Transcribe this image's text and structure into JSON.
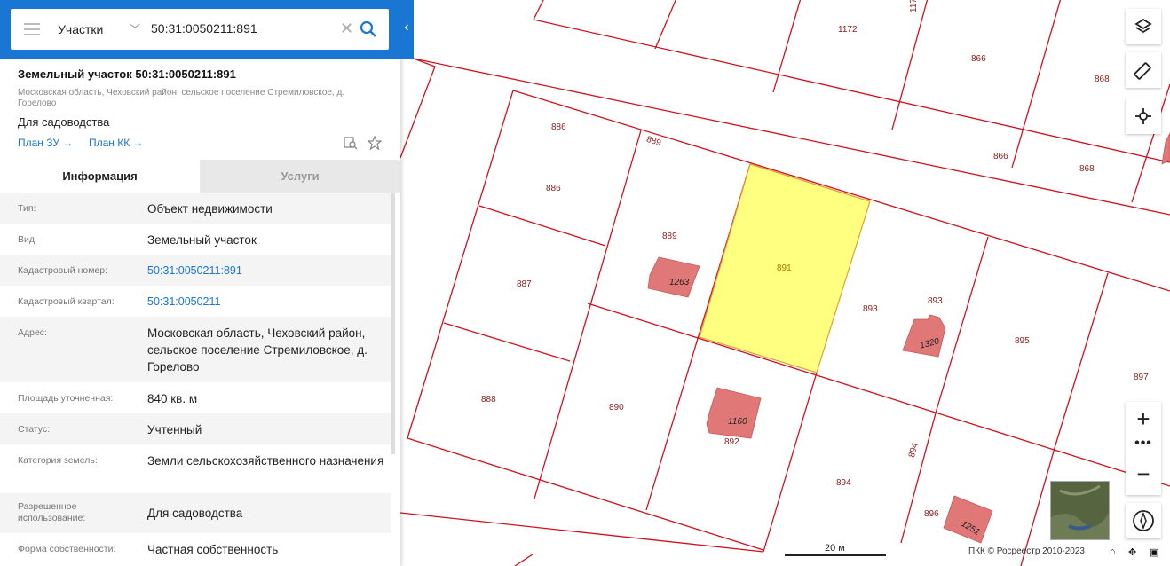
{
  "search": {
    "layer": "Участки",
    "query": "50:31:0050211:891"
  },
  "card": {
    "title": "Земельный участок 50:31:0050211:891",
    "address": "Московская область, Чеховский район, сельское поселение Стремиловское, д. Горелово",
    "purpose": "Для садоводства",
    "plan_zu": "План ЗУ →",
    "plan_kk": "План КК →"
  },
  "tabs": {
    "info": "Информация",
    "services": "Услуги"
  },
  "rows": [
    {
      "label": "Тип:",
      "value": "Объект недвижимости"
    },
    {
      "label": "Вид:",
      "value": "Земельный участок"
    },
    {
      "label": "Кадастровый номер:",
      "value": "50:31:0050211:891"
    },
    {
      "label": "Кадастровый квартал:",
      "value": "50:31:0050211"
    },
    {
      "label": "Адрес:",
      "value": "Московская область, Чеховский район, сельское поселение Стремиловское, д. Горелово"
    },
    {
      "label": "Площадь уточненная:",
      "value": "840 кв. м"
    },
    {
      "label": "Статус:",
      "value": "Учтенный"
    },
    {
      "label": "Категория земель:",
      "value": "Земли сельскохозяйственного назначения"
    },
    {
      "label": "Разрешенное использование:",
      "value": "Для садоводства"
    },
    {
      "label": "Форма собственности:",
      "value": "Частная собственность"
    }
  ],
  "map": {
    "parcel_labels": [
      "1172",
      "117",
      "866",
      "866",
      "868",
      "868",
      "886",
      "886",
      "889",
      "889",
      "891",
      "887",
      "893",
      "893",
      "895",
      "897",
      "888",
      "890",
      "892",
      "894",
      "894",
      "896"
    ],
    "building_labels": [
      "1263",
      "1320",
      "1160",
      "1251"
    ],
    "scale": "20 м",
    "copyright": "ПКК © Росреестр 2010-2023"
  },
  "colors": {
    "accent": "#1976d2",
    "parcel_border": "#d0101e",
    "selected_fill": "#ffff80",
    "building_fill": "#e07878"
  },
  "icons": [
    "menu-icon",
    "chevron-down-icon",
    "close-icon",
    "search-icon",
    "collapse-icon",
    "find-on-map-icon",
    "star-icon",
    "layers-icon",
    "ruler-icon",
    "locate-icon",
    "zoom-in-icon",
    "zoom-out-icon",
    "more-icon",
    "compass-icon",
    "home-icon"
  ]
}
